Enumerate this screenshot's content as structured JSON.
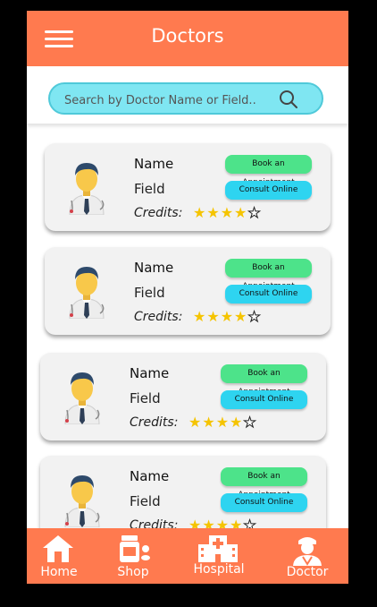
{
  "header": {
    "title": "Doctors"
  },
  "search": {
    "placeholder": "Search by Doctor Name or Field.."
  },
  "doctors": [
    {
      "name": "Name",
      "field": "Field",
      "credits_label": "Credits:",
      "book_label": "Book an Appointment",
      "consult_label": "Consult Online",
      "rating": 4,
      "rating_max": 5
    },
    {
      "name": "Name",
      "field": "Field",
      "credits_label": "Credits:",
      "book_label": "Book an Appointment",
      "consult_label": "Consult Online",
      "rating": 4,
      "rating_max": 5
    },
    {
      "name": "Name",
      "field": "Field",
      "credits_label": "Credits:",
      "book_label": "Book an Appointment",
      "consult_label": "Consult Online",
      "rating": 4,
      "rating_max": 5
    },
    {
      "name": "Name",
      "field": "Field",
      "credits_label": "Credits:",
      "book_label": "Book an Appointment",
      "consult_label": "Consult Online",
      "rating": 4,
      "rating_max": 5
    }
  ],
  "nav": {
    "home": "Home",
    "shop": "Shop",
    "hospital": "Hospital",
    "doctor": "Doctor"
  },
  "colors": {
    "accent": "#FF7A4F",
    "search_bg": "#7FE6F2",
    "book_button": "#4DE38A",
    "consult_button": "#2ED4F0",
    "star": "#F5C400"
  }
}
